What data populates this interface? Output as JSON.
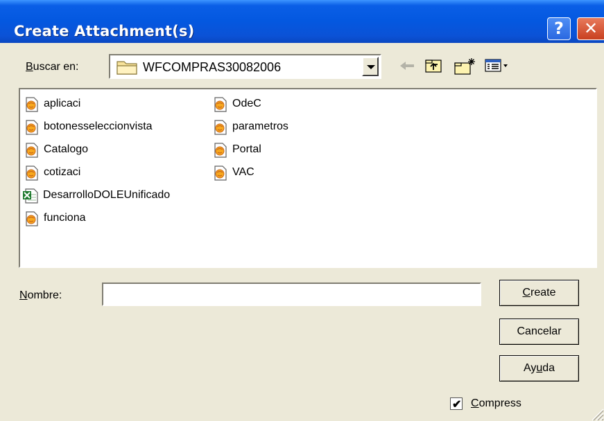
{
  "dialog": {
    "title": "Create Attachment(s)",
    "help_symbol": "?",
    "close_symbol": "✕"
  },
  "lookin": {
    "label_first": "B",
    "label_rest": "uscar en:",
    "current_folder": "WFCOMPRAS30082006"
  },
  "toolbar": [
    "back-icon",
    "up-folder-icon",
    "new-folder-icon",
    "view-menu-icon"
  ],
  "files": {
    "col1": [
      {
        "name": "aplicaci",
        "icon": "web-page-icon"
      },
      {
        "name": "botonesseleccionvista",
        "icon": "web-page-icon"
      },
      {
        "name": "Catalogo",
        "icon": "web-page-icon"
      },
      {
        "name": "cotizaci",
        "icon": "web-page-icon"
      },
      {
        "name": "DesarrolloDOLEUnificado",
        "icon": "excel-icon"
      },
      {
        "name": "funciona",
        "icon": "web-page-icon"
      }
    ],
    "col2": [
      {
        "name": "OdeC",
        "icon": "web-page-icon"
      },
      {
        "name": "parametros",
        "icon": "web-page-icon"
      },
      {
        "name": "Portal",
        "icon": "web-page-icon"
      },
      {
        "name": "VAC",
        "icon": "web-page-icon"
      }
    ]
  },
  "nombre": {
    "label_first": "N",
    "label_rest": "ombre:",
    "value": ""
  },
  "buttons": {
    "create_pre": "",
    "create_u": "C",
    "create_post": "reate",
    "cancel": "Cancelar",
    "help_pre": "Ay",
    "help_u": "u",
    "help_post": "da"
  },
  "compress": {
    "label_first": "C",
    "label_rest": "ompress",
    "checked": true
  }
}
